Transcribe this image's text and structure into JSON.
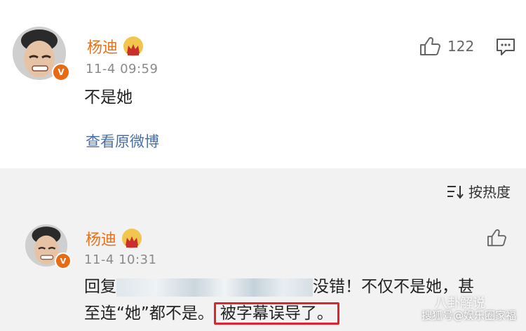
{
  "comment1": {
    "author": "杨迪",
    "time": "11-4 09:59",
    "text": "不是她",
    "link": "查看原微博",
    "likes": "122"
  },
  "sort": {
    "label": "按热度"
  },
  "reply1": {
    "author": "杨迪",
    "time": "11-4 10:31",
    "text_prefix": "回复",
    "text_after_blur": "没错！不仅不是她，甚",
    "line2_before": "至连“她”都不是。",
    "line2_highlight": "被字幕误导了。"
  },
  "watermark": {
    "line1": "八卦解说",
    "line2": "搜狐号@娱乐圈家福"
  },
  "colors": {
    "name": "#e8711b",
    "link": "#4a6fa5",
    "highlight": "#e0242f",
    "badge": "#e86a12"
  }
}
